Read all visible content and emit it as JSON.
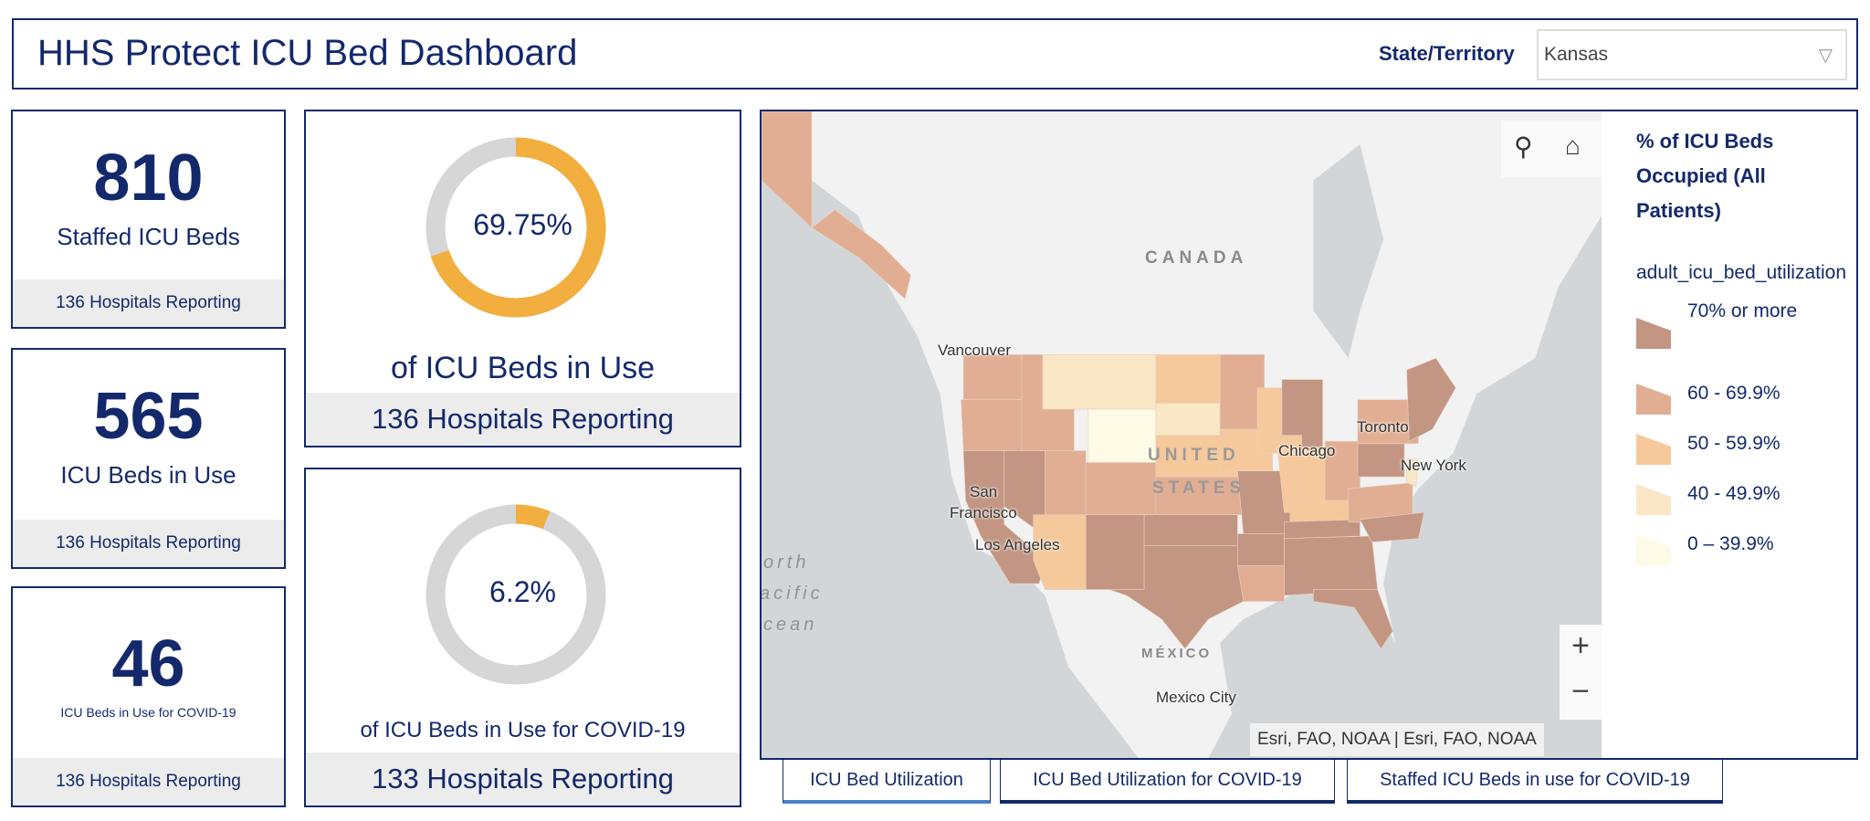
{
  "header": {
    "title": "HHS Protect ICU Bed Dashboard",
    "state_label": "State/Territory",
    "state_value": "Kansas",
    "caret_icon": "triangle-down"
  },
  "kpis": [
    {
      "value": "810",
      "label": "Staffed ICU Beds",
      "footer": "136 Hospitals Reporting"
    },
    {
      "value": "565",
      "label": "ICU Beds in Use",
      "footer": "136 Hospitals Reporting"
    },
    {
      "value": "46",
      "label": "ICU Beds in Use for COVID-19",
      "footer": "136 Hospitals Reporting"
    }
  ],
  "gauges": [
    {
      "percent": 69.75,
      "percent_text": "69.75%",
      "label": "of ICU Beds in Use",
      "footer": "136 Hospitals Reporting"
    },
    {
      "percent": 6.2,
      "percent_text": "6.2%",
      "label": "of ICU Beds in Use for COVID-19",
      "footer": "133 Hospitals Reporting"
    }
  ],
  "colors": {
    "navy": "#14296b",
    "gauge_fill": "#f2ae3e",
    "gauge_track": "#d6d6d6",
    "c70": "#c39583",
    "c60": "#e1ae93",
    "c50": "#f5c99c",
    "c40": "#f9e7c5",
    "c0": "#fdfbe6"
  },
  "map": {
    "labels": {
      "canada": "CANADA",
      "us1": "UNITED",
      "us2": "STATES",
      "mexico": "MÉXICO",
      "vancouver": "Vancouver",
      "sf1": "San",
      "sf2": "Francisco",
      "la": "Los Angeles",
      "chicago": "Chicago",
      "toronto": "Toronto",
      "newyork": "New York",
      "mexicocity": "Mexico City",
      "ocean1": "orth",
      "ocean2": "acific",
      "ocean3": "cean"
    },
    "attribution": "Esri, FAO, NOAA | Esri, FAO, NOAA",
    "tools": {
      "search_icon": "⚲",
      "home_icon": "⌂",
      "zoom_in": "+",
      "zoom_out": "−"
    }
  },
  "legend": {
    "title": "% of ICU Beds Occupied (All Patients)",
    "field": "adult_icu_bed_utilization",
    "items": [
      {
        "label": "70% or more",
        "color": "#c39583"
      },
      {
        "label": "60 - 69.9%",
        "color": "#e1ae93"
      },
      {
        "label": "50 - 59.9%",
        "color": "#f5c99c"
      },
      {
        "label": "40 - 49.9%",
        "color": "#f9e7c5"
      },
      {
        "label": "0 – 39.9%",
        "color": "#fdfbe6"
      }
    ]
  },
  "tabs": [
    {
      "label": "ICU Bed Utilization",
      "active": true
    },
    {
      "label": "ICU Bed Utilization for COVID-19",
      "active": false
    },
    {
      "label": "Staffed ICU Beds in use for COVID-19",
      "active": false
    }
  ]
}
